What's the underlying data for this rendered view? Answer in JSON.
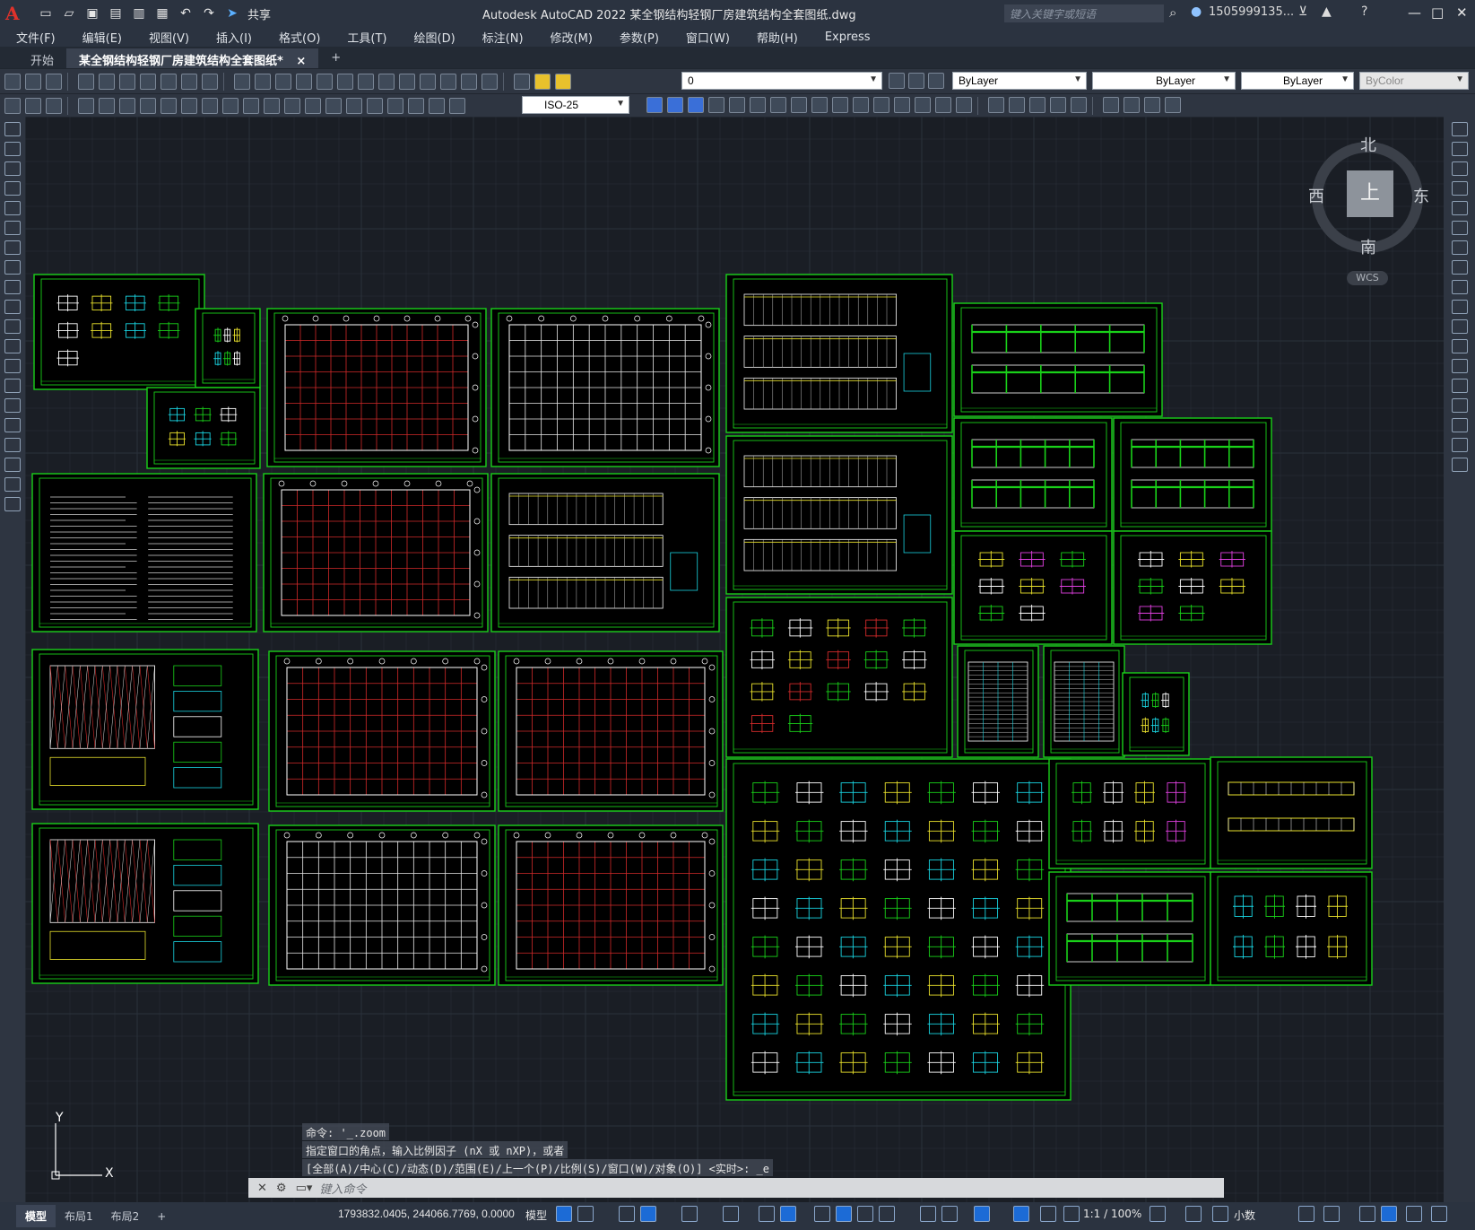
{
  "app": {
    "logo": "A",
    "title": "Autodesk AutoCAD 2022    某全钢结构轻钢厂房建筑结构全套图纸.dwg",
    "share_label": "共享",
    "search_placeholder": "键入关键字或短语",
    "user": "1505999135..."
  },
  "menu": [
    "文件(F)",
    "编辑(E)",
    "视图(V)",
    "插入(I)",
    "格式(O)",
    "工具(T)",
    "绘图(D)",
    "标注(N)",
    "修改(M)",
    "参数(P)",
    "窗口(W)",
    "帮助(H)",
    "Express"
  ],
  "tabs": {
    "start": "开始",
    "document": "某全钢结构轻钢厂房建筑结构全套图纸*",
    "close": "×",
    "add": "+"
  },
  "toolbar": {
    "layer_value": "0",
    "color_value": "ByLayer",
    "linetype_value": "ByLayer",
    "lineweight_value": "ByLayer",
    "plotstyle_value": "ByColor",
    "dimstyle_value": "ISO-25"
  },
  "viewcube": {
    "top": "上",
    "north": "北",
    "south": "南",
    "east": "东",
    "west": "西",
    "wcs": "WCS"
  },
  "ucs": {
    "x": "X",
    "y": "Y"
  },
  "command": {
    "history": [
      "命令: '_.zoom",
      "指定窗口的角点，输入比例因子 (nX 或 nXP)，或者",
      "[全部(A)/中心(C)/动态(D)/范围(E)/上一个(P)/比例(S)/窗口(W)/对象(O)] <实时>: _e"
    ],
    "placeholder": "键入命令"
  },
  "status": {
    "layouts": [
      "模型",
      "布局1",
      "布局2"
    ],
    "add_layout": "+",
    "coords": "1793832.0405, 244066.7769, 0.0000",
    "space": "模型",
    "scale": "1:1 / 100%",
    "units": "小数"
  },
  "colors": {
    "frame": "#19d019",
    "grid": "#2a313b",
    "red_axis": "#d12a2a",
    "detail_cyan": "#19d3e0",
    "detail_magenta": "#e040e0",
    "detail_yellow": "#e8e02c"
  }
}
